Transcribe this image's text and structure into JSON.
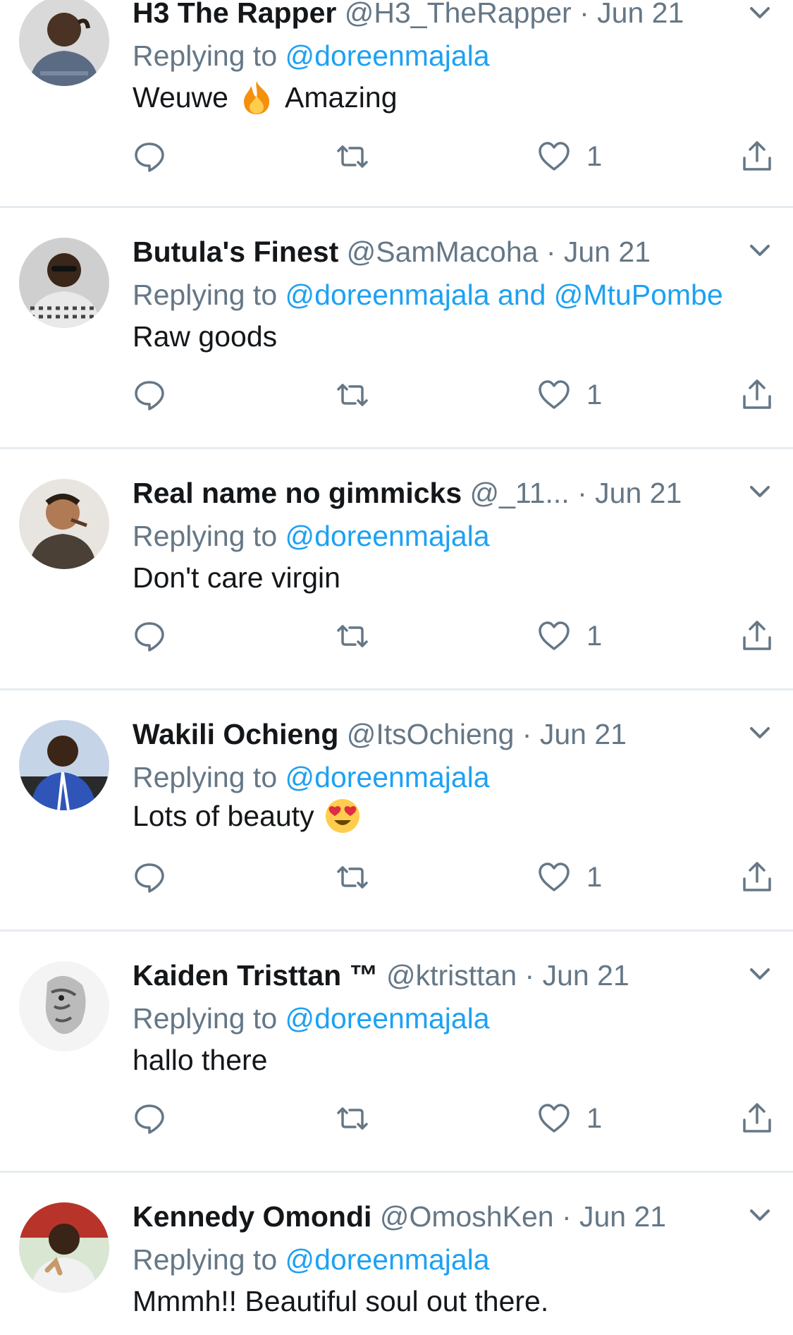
{
  "tweets": [
    {
      "name": "H3 The Rapper",
      "handle": "@H3_TheRapper",
      "date": "Jun 21",
      "replying_prefix": "Replying to ",
      "replying_to": "@doreenmajala",
      "text_before": "Weuwe",
      "emoji": "fire-emoji",
      "text_after": "Amazing",
      "likes": "1"
    },
    {
      "name": "Butula's Finest",
      "handle": "@SamMacoha",
      "date": "Jun 21",
      "replying_prefix": "Replying to ",
      "replying_to": "@doreenmajala and @MtuPombe",
      "text_before": "Raw goods",
      "likes": "1"
    },
    {
      "name": "Real name no gimmicks",
      "handle": "@_11...",
      "date": "Jun 21",
      "replying_prefix": "Replying to ",
      "replying_to": "@doreenmajala",
      "text_before": "Don't care virgin",
      "likes": "1"
    },
    {
      "name": "Wakili Ochieng",
      "handle": "@ItsOchieng",
      "date": "Jun 21",
      "replying_prefix": "Replying to ",
      "replying_to": "@doreenmajala",
      "text_before": "Lots of beauty",
      "emoji": "heart-eyes-emoji",
      "likes": "1"
    },
    {
      "name": "Kaiden Tristtan ™",
      "handle": "@ktristtan",
      "date": "Jun 21",
      "replying_prefix": "Replying to ",
      "replying_to": "@doreenmajala",
      "text_before": "hallo there",
      "likes": "1"
    },
    {
      "name": "Kennedy Omondi",
      "handle": "@OmoshKen",
      "date": "Jun 21",
      "replying_prefix": "Replying to ",
      "replying_to": "@doreenmajala",
      "text_before": "Mmmh!! Beautiful soul out there."
    }
  ],
  "separator": " · ",
  "colors": {
    "link": "#1da1f2",
    "secondary": "#657786",
    "divider": "#e6ecf0"
  }
}
